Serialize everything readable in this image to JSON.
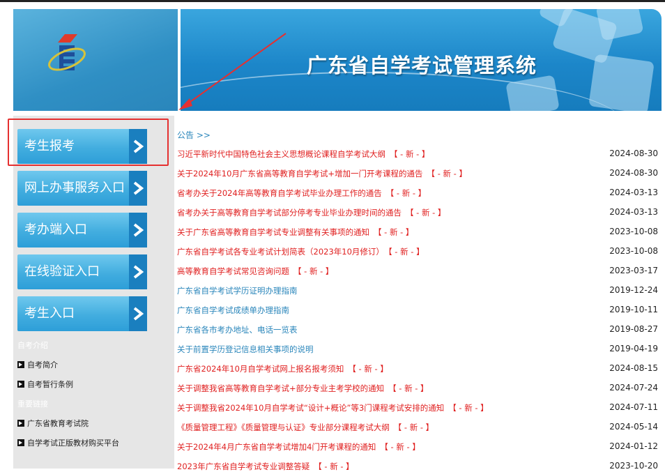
{
  "header": {
    "title": "广东省自学考试管理系统",
    "logo_icon": "exam-logo-icon"
  },
  "sidebar": {
    "buttons": [
      {
        "label": "考生报考"
      },
      {
        "label": "网上办事服务入口"
      },
      {
        "label": "考办端入口"
      },
      {
        "label": "在线验证入口"
      },
      {
        "label": "考生入口"
      }
    ],
    "section_intro": "自考介绍",
    "intro_links": [
      "自考简介",
      "自考暂行条例"
    ],
    "section_links": "重要链接",
    "important_links": [
      "广东省教育考试院",
      "自学考试正版教材购买平台"
    ]
  },
  "main": {
    "notice_title": "公告 >>",
    "badge": "【 - 新 - 】",
    "notices": [
      {
        "title": "习近平新时代中国特色社会主义思想概论课程自学考试大纲",
        "date": "2024-08-30",
        "new": true
      },
      {
        "title": "关于2024年10月广东省高等教育自学考试+增加一门开考课程的通告",
        "date": "2024-08-30",
        "new": true
      },
      {
        "title": "省考办关于2024年高等教育自学考试毕业办理工作的通告",
        "date": "2024-03-13",
        "new": true
      },
      {
        "title": "省考办关于高等教育自学考试部分停考专业毕业办理时间的通告",
        "date": "2024-03-13",
        "new": true
      },
      {
        "title": "关于广东省高等教育自学考试专业调整有关事项的通知",
        "date": "2023-10-08",
        "new": true
      },
      {
        "title": "广东省自学考试各专业考试计划简表（2023年10月修订）",
        "date": "2023-10-08",
        "new": true
      },
      {
        "title": "高等教育自学考试常见咨询问题",
        "date": "2023-03-17",
        "new": true
      },
      {
        "title": "广东省自学考试学历证明办理指南",
        "date": "2019-12-24",
        "new": false
      },
      {
        "title": "广东省自学考试成绩单办理指南",
        "date": "2019-10-11",
        "new": false
      },
      {
        "title": "广东省各市考办地址、电话一览表",
        "date": "2019-08-27",
        "new": false
      },
      {
        "title": "关于前置学历登记信息相关事项的说明",
        "date": "2019-04-19",
        "new": false
      },
      {
        "title": "广东省2024年10月自学考试网上报名报考须知",
        "date": "2024-08-15",
        "new": true
      },
      {
        "title": "关于调整我省高等教育自学考试+部分专业主考学校的通知",
        "date": "2024-07-24",
        "new": true
      },
      {
        "title": "关于调整我省2024年10月自学考试“设计+概论”等3门课程考试安排的通知",
        "date": "2024-07-11",
        "new": true
      },
      {
        "title": "《质量管理工程》《质量管理与认证》专业部分课程考试大纲",
        "date": "2024-05-14",
        "new": true
      },
      {
        "title": "关于2024年4月广东省自学考试增加4门开考课程的通知",
        "date": "2024-01-12",
        "new": true
      },
      {
        "title": "2023年广东省自学考试专业调整答疑",
        "date": "2023-10-20",
        "new": true
      }
    ]
  },
  "colors": {
    "accent": "#2a86bb",
    "notice_red": "#e02020",
    "annotation": "#e53030"
  }
}
